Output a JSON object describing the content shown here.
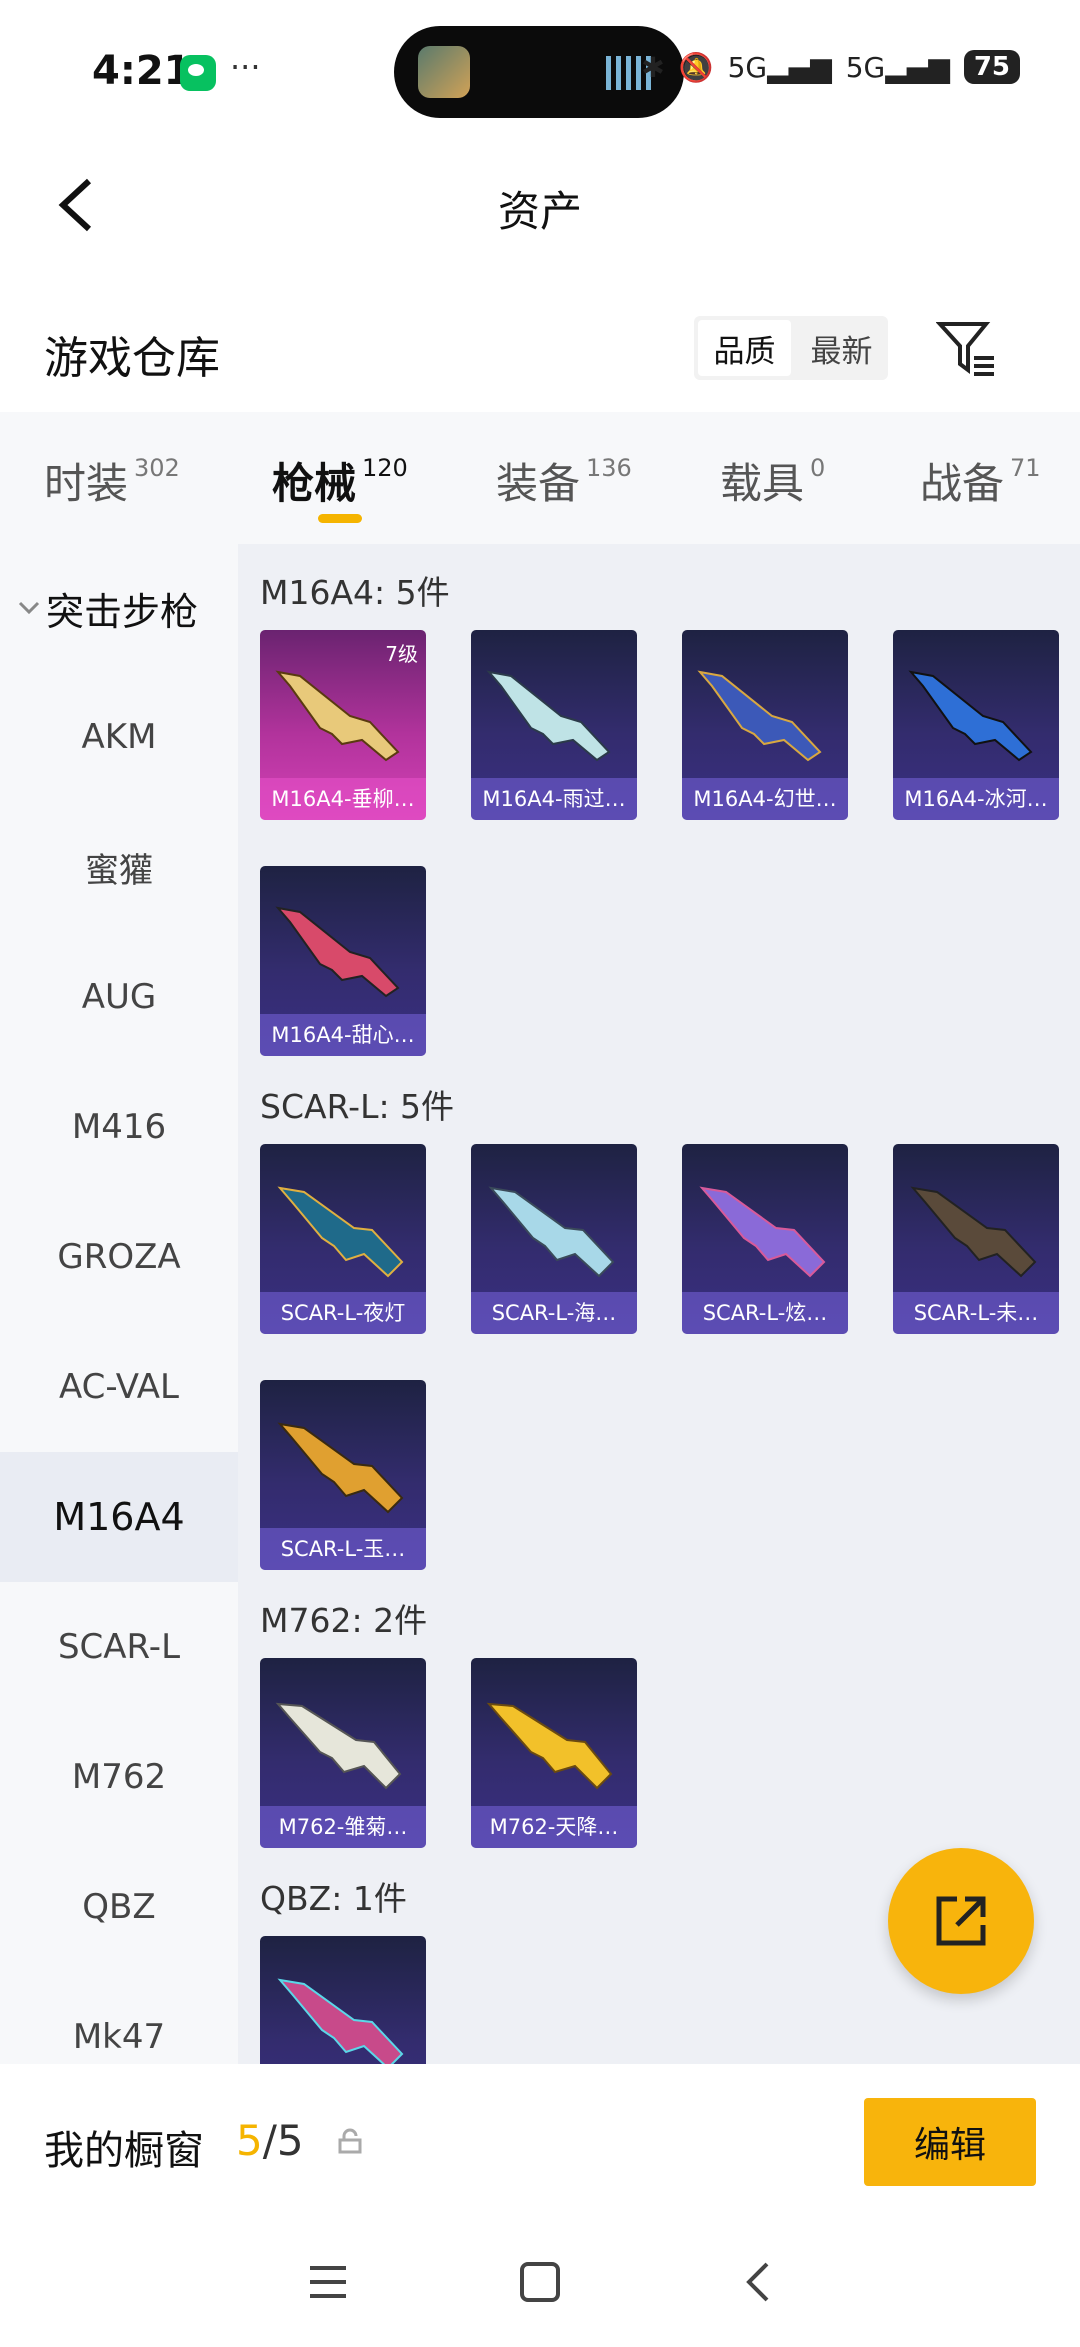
{
  "status_bar": {
    "time": "4:21",
    "battery": "75",
    "network": "5G"
  },
  "header": {
    "title": "资产"
  },
  "warehouse": {
    "title": "游戏仓库",
    "sort_options": [
      "品质",
      "最新"
    ],
    "active_sort": "品质"
  },
  "tabs": [
    {
      "label": "时装",
      "count": "302"
    },
    {
      "label": "枪械",
      "count": "120",
      "active": true
    },
    {
      "label": "装备",
      "count": "136"
    },
    {
      "label": "载具",
      "count": "0"
    },
    {
      "label": "战备",
      "count": "71"
    }
  ],
  "side_nav": {
    "group": "突击步枪",
    "items": [
      "AKM",
      "蜜獾",
      "AUG",
      "M416",
      "GROZA",
      "AC-VAL",
      "M16A4",
      "SCAR-L",
      "M762",
      "QBZ",
      "Mk47"
    ],
    "active": "M16A4"
  },
  "sections": [
    {
      "title": "M16A4: 5件",
      "items": [
        {
          "name": "M16A4-垂柳…",
          "level": "7级",
          "rarity": "pink"
        },
        {
          "name": "M16A4-雨过…"
        },
        {
          "name": "M16A4-幻世…"
        },
        {
          "name": "M16A4-冰河…"
        },
        {
          "name": "M16A4-甜心…"
        }
      ]
    },
    {
      "title": "SCAR-L: 5件",
      "items": [
        {
          "name": "SCAR-L-夜灯"
        },
        {
          "name": "SCAR-L-海…"
        },
        {
          "name": "SCAR-L-炫…"
        },
        {
          "name": "SCAR-L-未…"
        },
        {
          "name": "SCAR-L-玉…"
        }
      ]
    },
    {
      "title": "M762: 2件",
      "items": [
        {
          "name": "M762-雏菊…"
        },
        {
          "name": "M762-天降…"
        }
      ]
    },
    {
      "title": "QBZ: 1件",
      "items": [
        {
          "name": ""
        }
      ]
    }
  ],
  "showcase": {
    "title": "我的橱窗",
    "current": "5",
    "total": "/5",
    "edit_label": "编辑"
  },
  "colors": {
    "accent": "#f8b40c",
    "card_purple": "#3a2f82",
    "card_pink": "#d341b6"
  }
}
